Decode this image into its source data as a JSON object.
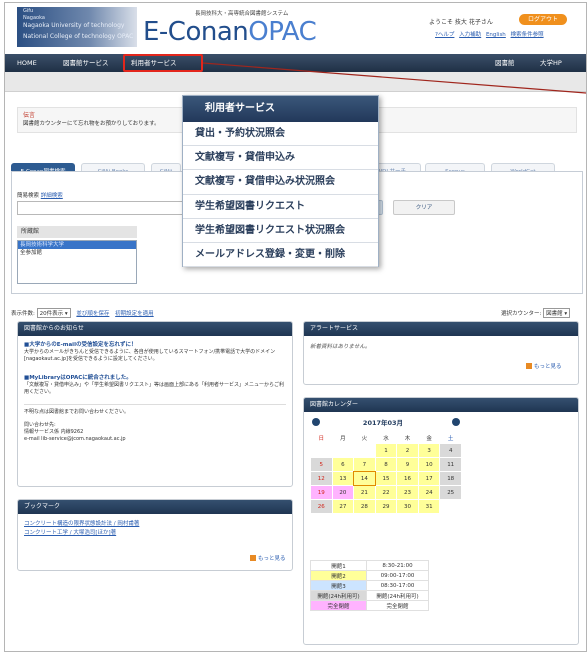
{
  "header": {
    "logo_lines": [
      "Gifu",
      "Nagaoka",
      "Nagaoka University of technology",
      "National College of technology OPAC"
    ],
    "brand_top": "長岡技科大・高専統合図書館システム",
    "brand_dark": "E-Conan",
    "brand_light": "OPAC",
    "welcome": "ようこそ 技大 花子さん",
    "logout": "ログアウト",
    "help_links": [
      "?ヘルプ",
      "入力補助",
      "English",
      "検索条件参照"
    ]
  },
  "nav": {
    "home": "HOME",
    "library_service": "図書館サービス",
    "user_service": "利用者サービス",
    "right": [
      "図書館",
      "大学HP"
    ]
  },
  "notice": {
    "title": "伝言",
    "text": "図書館カウンターにて忘れ物をお預かりしております。"
  },
  "search": {
    "tabs": [
      "E-Conan図書検索",
      "CiNii Books",
      "CiNii",
      "NDLサーチ",
      "Scopus",
      "WorldCat"
    ],
    "simple": "簡易検索",
    "detail": "詳細検索",
    "search_btn": "検索",
    "clear_btn": "クリア",
    "lib_head": "所蔵館",
    "libraries": [
      "長岡技術科学大学",
      "全参加館"
    ]
  },
  "options": {
    "display_label": "表示件数:",
    "display_value": "20件表示",
    "save": "並び順を保存",
    "reset": "初期設定を適用",
    "counter_label": "選択カウンター:",
    "counter_value": "図書館"
  },
  "news": {
    "title": "図書館からのお知らせ",
    "items": [
      {
        "head": "■大学からのE-mailの受信設定を忘れずに！",
        "body": "大学からのメールがきちんと受信できるように、各自が使用しているスマートフォン/携帯電話で大学のドメイン[nagaokaut.ac.jp]を受信できるように設定してください。"
      },
      {
        "head": "■MyLibraryはOPACに統合されました。",
        "body": "「文献複写・貸借申込み」や「学生希望図書リクエスト」等は画面上部にある「利用者サービス」メニューからご利用ください。"
      }
    ],
    "footer": [
      "不明な点は図書館までお問い合わせください。",
      "問い合わせ先:",
      "情報サービス係 内線9262",
      "e-mail lib-service@jcom.nagaokaut.ac.jp"
    ]
  },
  "alert": {
    "title": "アラートサービス",
    "text": "新着資料はありません。",
    "more": "もっと見る"
  },
  "calendar": {
    "title": "図書館カレンダー",
    "month": "2017年03月",
    "weekdays": [
      "日",
      "月",
      "火",
      "水",
      "木",
      "金",
      "土"
    ],
    "legend": [
      {
        "label": "開館1",
        "hours": "8:30-21:00",
        "color": "#ffffff"
      },
      {
        "label": "開館2",
        "hours": "09:00-17:00",
        "color": "#ffff99"
      },
      {
        "label": "開館3",
        "hours": "08:30-17:00",
        "color": "#cce4ff"
      },
      {
        "label": "開館(24h利用可)",
        "hours": "開館(24h利用可)",
        "color": "#d9d9d9"
      },
      {
        "label": "完全閉館",
        "hours": "完全閉館",
        "color": "#ffb3ff"
      }
    ]
  },
  "bookmark": {
    "title": "ブックマーク",
    "items": [
      "コンクリート構造の限界状態設計法 / 岡村甫著",
      "コンクリート工学 / 大塚浩司[ほか]著"
    ],
    "more": "もっと見る"
  },
  "menu": {
    "title": "利用者サービス",
    "items": [
      "貸出・予約状況照会",
      "文献複写・貸借申込み",
      "文献複写・貸借申込み状況照会",
      "学生希望図書リクエスト",
      "学生希望図書リクエスト状況照会",
      "メールアドレス登録・変更・削除"
    ]
  }
}
